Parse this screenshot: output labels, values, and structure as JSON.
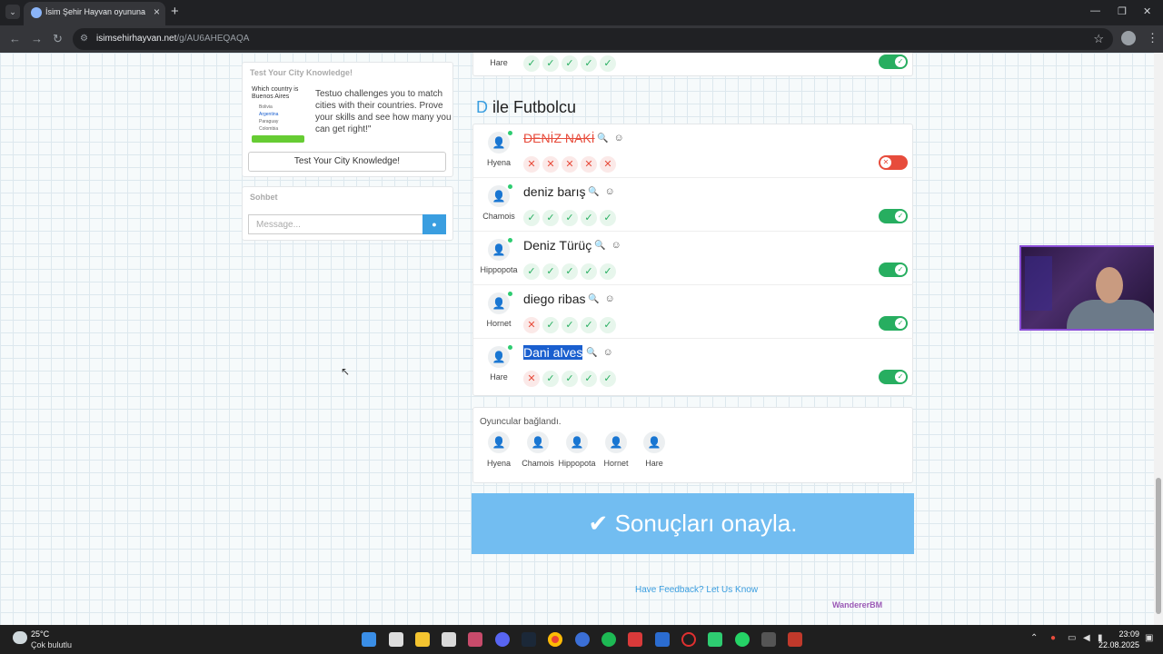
{
  "browser": {
    "tab_title": "İsim Şehir Hayvan oyununa katıl",
    "url_domain": "isimsehirhayvan.net",
    "url_path": "/g/AU6AHEQAQA"
  },
  "sidebar": {
    "ad": {
      "title": "Test Your City Knowledge!",
      "question": "Which country is Buenos Aires",
      "options": [
        "Bolivia",
        "Argentina",
        "Paraguay",
        "Colombia"
      ],
      "text": "Testuo challenges you to match cities with their countries. Prove your skills and see how many you can get right!\"",
      "button": "Test Your City Knowledge!"
    },
    "chat": {
      "title": "Sohbet",
      "placeholder": "Message..."
    }
  },
  "top_row": {
    "player": "Hare",
    "votes": [
      "ok",
      "ok",
      "ok",
      "ok",
      "ok"
    ],
    "toggle": "on"
  },
  "category": {
    "letter": "D",
    "title": "ile Futbolcu"
  },
  "answers": [
    {
      "player": "Hyena",
      "answer": "DENİZ NAKİ",
      "state": "wrong",
      "votes": [
        "no",
        "no",
        "no",
        "no",
        "no"
      ],
      "toggle": "off"
    },
    {
      "player": "Chamois",
      "answer": "deniz barış",
      "state": "normal",
      "votes": [
        "ok",
        "ok",
        "ok",
        "ok",
        "ok"
      ],
      "toggle": "on"
    },
    {
      "player": "Hippopota",
      "answer": "Deniz Türüç",
      "state": "normal",
      "votes": [
        "ok",
        "ok",
        "ok",
        "ok",
        "ok"
      ],
      "toggle": "on"
    },
    {
      "player": "Hornet",
      "answer": "diego ribas",
      "state": "normal",
      "votes": [
        "no",
        "ok",
        "ok",
        "ok",
        "ok"
      ],
      "toggle": "on"
    },
    {
      "player": "Hare",
      "answer": "Dani alves",
      "state": "selected",
      "votes": [
        "no",
        "ok",
        "ok",
        "ok",
        "ok"
      ],
      "toggle": "on"
    }
  ],
  "players_panel": {
    "title": "Oyuncular bağlandı.",
    "players": [
      "Hyena",
      "Chamois",
      "Hippopota",
      "Hornet",
      "Hare"
    ]
  },
  "confirm_button": "Sonuçları onayla.",
  "feedback_link": "Have Feedback? Let Us Know",
  "stream_overlay": "WandererBM",
  "taskbar": {
    "temperature": "25°C",
    "weather": "Çok bulutlu",
    "time": "23:09",
    "date": "22.08.2025"
  }
}
